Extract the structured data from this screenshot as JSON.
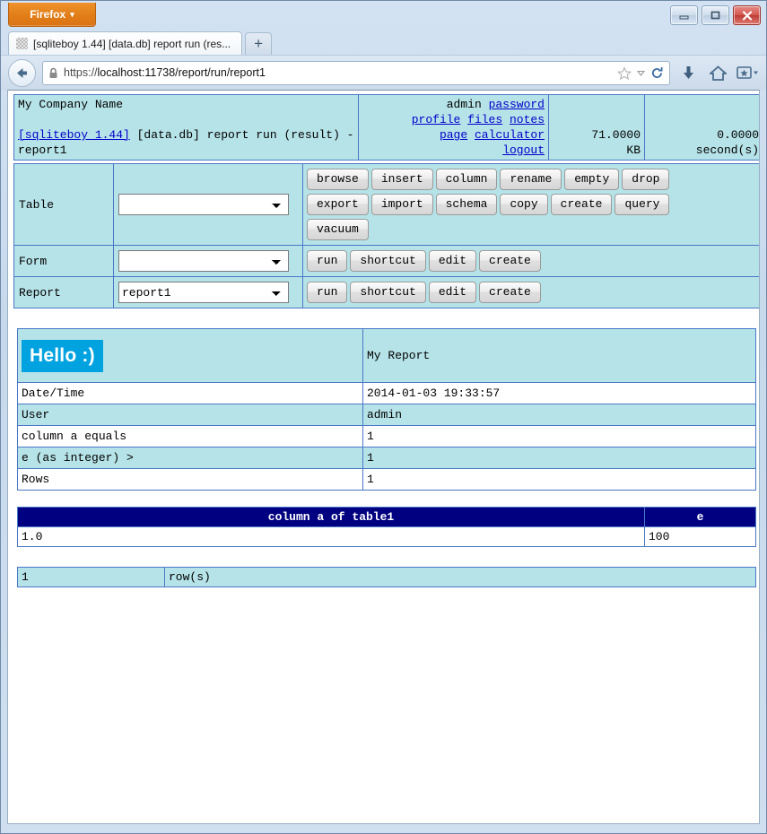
{
  "browser": {
    "app_button": "Firefox",
    "app_button_caret": "▾",
    "tab_title": "[sqliteboy 1.44] [data.db] report run (res...",
    "new_tab_label": "+",
    "url_scheme": "https://",
    "url_rest": "localhost:11738/report/run/report1",
    "window_controls": {
      "minimize": "–",
      "maximize": "□",
      "close": "✕"
    }
  },
  "header": {
    "company": "My Company Name",
    "brand_link": "[sqliteboy 1.44]",
    "brand_rest": " [data.db] report run (result) - report1",
    "user": "admin",
    "links": [
      "password",
      "profile",
      "files",
      "notes",
      "page",
      "calculator",
      "logout"
    ],
    "size_value": "71.0000",
    "size_unit": "KB",
    "time_value": "0.0000",
    "time_unit": "second(s)"
  },
  "controls": {
    "rows": [
      {
        "label": "Table",
        "select_value": "",
        "buttons": [
          "browse",
          "insert",
          "column",
          "rename",
          "empty",
          "drop",
          "export",
          "import",
          "schema",
          "copy",
          "create",
          "query",
          "vacuum"
        ]
      },
      {
        "label": "Form",
        "select_value": "",
        "buttons": [
          "run",
          "shortcut",
          "edit",
          "create"
        ]
      },
      {
        "label": "Report",
        "select_value": "report1",
        "buttons": [
          "run",
          "shortcut",
          "edit",
          "create"
        ]
      }
    ]
  },
  "report": {
    "banner_text": "Hello :)",
    "banner_color": "#00a3e0",
    "title": "My Report",
    "rows": [
      {
        "key": "Date/Time",
        "value": "2014-01-03 19:33:57"
      },
      {
        "key": "User",
        "value": "admin"
      },
      {
        "key": "column a equals",
        "value": "1"
      },
      {
        "key": "e (as integer) >",
        "value": "1"
      },
      {
        "key": "Rows",
        "value": "1"
      }
    ]
  },
  "result": {
    "columns": [
      "column a of table1",
      "e"
    ],
    "rows": [
      [
        "1.0",
        "100"
      ]
    ],
    "row_count": "1",
    "row_count_label": "row(s)"
  },
  "colors": {
    "panel_bg": "#b6e3e8",
    "border": "#4a78c8",
    "grid_header": "#000080",
    "link": "#0000cc"
  }
}
